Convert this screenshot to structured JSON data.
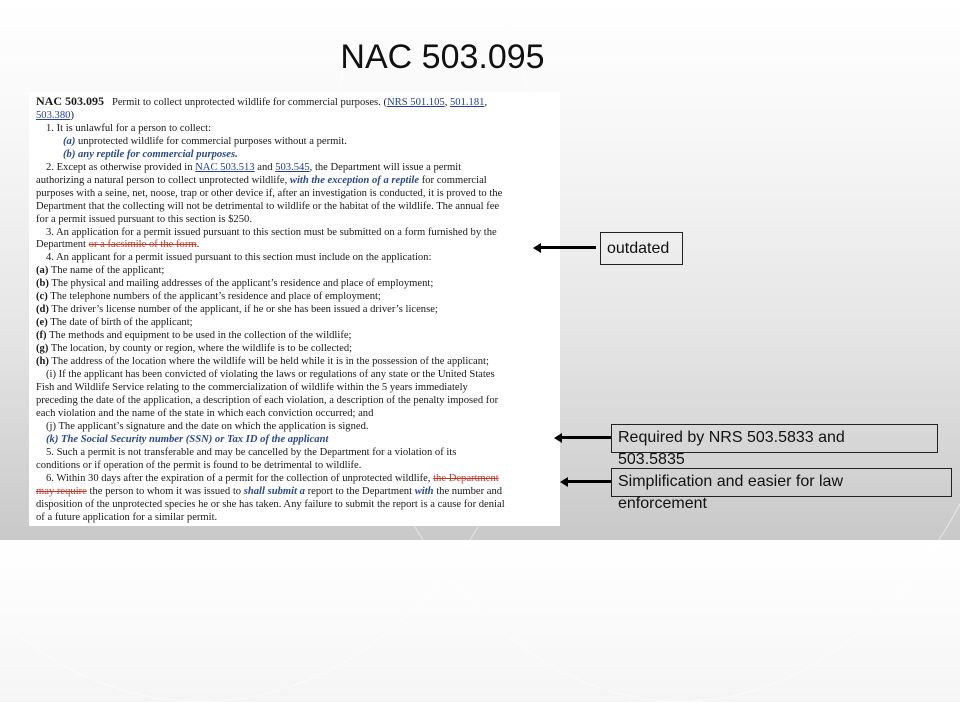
{
  "slide": {
    "title": "NAC 503.095"
  },
  "document": {
    "section_number": "NAC  503.095",
    "section_heading": "Permit to collect unprotected wildlife for commercial purposes. (",
    "citations": [
      "NRS 501.105",
      "501.181",
      "503.380"
    ],
    "citation_sep": ", ",
    "citation_close": ")",
    "lines": {
      "p1": "1.   It is unlawful for a person to collect:",
      "p1a_ins": "(a)",
      "p1a_text": " unprotected wildlife for commercial purposes without a permit.",
      "p1b_ins": "(b) any reptile for commercial purposes.",
      "p2_a": "2.   Except as otherwise provided in ",
      "p2_link1": "NAC 503.513",
      "p2_b": " and ",
      "p2_link2": "503.545",
      "p2_c": ", the Department will issue a permit",
      "p2_l2a": "authorizing a natural person to collect unprotected wildlife, ",
      "p2_l2_ins": "with the exception of a reptile",
      "p2_l2b": " for commercial",
      "p2_l3": "purposes with a seine, net, noose, trap or other device if, after an investigation is conducted, it is proved to the",
      "p2_l4": "Department that the collecting will not be detrimental to wildlife or the habitat of the wildlife. The annual fee",
      "p2_l5": "for a permit issued pursuant to this section is $250.",
      "p3_l1": "3.   An application for a permit issued pursuant to this section must be submitted on a form furnished by the",
      "p3_l2a": "Department ",
      "p3_l2_del": "or a facsimile of the form",
      "p3_l2b": ".",
      "p4": "4.   An applicant for a permit issued pursuant to this section must include on the application:",
      "p4_items": [
        {
          "label": "(a)",
          "text": "The name of the applicant;"
        },
        {
          "label": "(b)",
          "text": "The physical and mailing addresses of the applicant’s residence and place of employment;"
        },
        {
          "label": "(c)",
          "text": "The telephone numbers of the applicant’s residence and place of employment;"
        },
        {
          "label": "(d)",
          "text": "The driver’s license number of the applicant, if he or she has been issued a driver’s license;"
        },
        {
          "label": "(e)",
          "text": "The date of birth of the applicant;"
        },
        {
          "label": "(f)",
          "text": "The methods and equipment to be used in the collection of the wildlife;"
        },
        {
          "label": "(g)",
          "text": "The location, by county or region, where the wildlife is to be collected;"
        },
        {
          "label": "(h)",
          "text": "The address of the location where the wildlife will be held while it is in the possession of the applicant;"
        }
      ],
      "p4i_l1": "(i)  If the applicant has been convicted of violating the laws or regulations of any state or the United States",
      "p4i_l2": "Fish and Wildlife Service relating to the commercialization of wildlife within the 5 years immediately",
      "p4i_l3": "preceding the date of the application, a description of each violation, a description of the penalty imposed for",
      "p4i_l4": "each violation and the name of the state in which each conviction occurred; and",
      "p4j": "(j)  The applicant’s signature and the date on which the application is signed.",
      "p4k_ins": "(k) The Social Security number (SSN) or Tax ID of the applicant",
      "p5_l1": "5.   Such a permit is not transferable and may be cancelled by the Department for a violation of its",
      "p5_l2": "conditions or if operation of the permit is found to be detrimental to wildlife.",
      "p6_l1a": "6.   Within 30 days after the expiration of a permit for the collection of unprotected wildlife, ",
      "p6_l1_del": "the Department",
      "p6_l2_del": "may require",
      "p6_l2a": " the person to whom it was issued to ",
      "p6_l2_ins1": "shall submit a",
      "p6_l2b": " report to the Department ",
      "p6_l2_ins2": "with",
      "p6_l2c": " the number and",
      "p6_l3": "disposition of the unprotected species he or she has taken. Any failure to submit the report is a cause for denial",
      "p6_l4": "of a future application for a similar permit."
    }
  },
  "callouts": [
    {
      "label": "outdated"
    },
    {
      "label": "Required by NRS 503.5833 and 503.5835"
    },
    {
      "label": "Simplification and easier for law enforcement"
    }
  ],
  "colors": {
    "inserted_text": "#2a4a8e",
    "deleted_text": "#c0392b",
    "link": "#1f3f9a"
  }
}
